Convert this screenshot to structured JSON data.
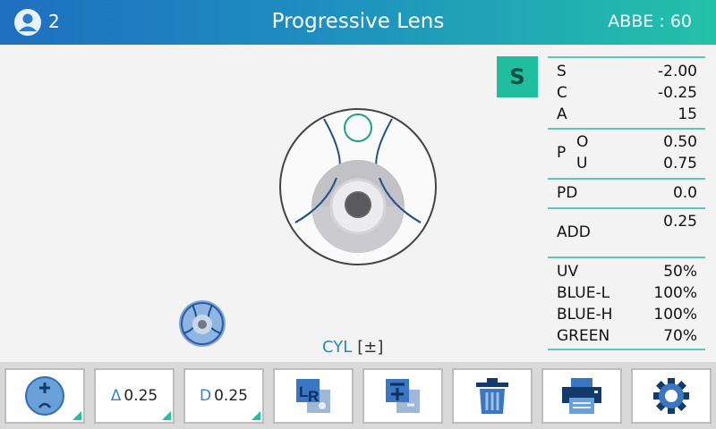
{
  "header": {
    "user_count": "2",
    "title": "Progressive Lens",
    "abbe": "ABBE : 60"
  },
  "main": {
    "mode_badge": "S",
    "cyl_label": "CYL",
    "cyl_sign": "[±]"
  },
  "readings": {
    "s": {
      "label": "S",
      "value": "-2.00"
    },
    "c": {
      "label": "C",
      "value": "-0.25"
    },
    "a": {
      "label": "A",
      "value": "15"
    },
    "p": {
      "label": "P",
      "o_label": "O",
      "o_value": "0.50",
      "u_label": "U",
      "u_value": "0.75"
    },
    "pd": {
      "label": "PD",
      "value": "0.0"
    },
    "add": {
      "label": "ADD",
      "value": "0.25"
    },
    "uv": {
      "label": "UV",
      "value": "50%"
    },
    "blue_l": {
      "label": "BLUE-L",
      "value": "100%"
    },
    "blue_h": {
      "label": "BLUE-H",
      "value": "100%"
    },
    "green": {
      "label": "GREEN",
      "value": "70%"
    }
  },
  "toolbar": {
    "prism_step_symbol": "Δ",
    "prism_step_value": "0.25",
    "diopter_step_symbol": "D",
    "diopter_step_value": "0.25",
    "icons": [
      "lens-add-icon",
      "prism-step",
      "diopter-step",
      "lr-icon",
      "transpose-icon",
      "trash-icon",
      "printer-icon",
      "gear-icon"
    ]
  },
  "colors": {
    "header_start": "#1f6fc0",
    "header_end": "#23c2a8",
    "accent": "#20bd9e",
    "icon_blue": "#3b7fc4"
  }
}
